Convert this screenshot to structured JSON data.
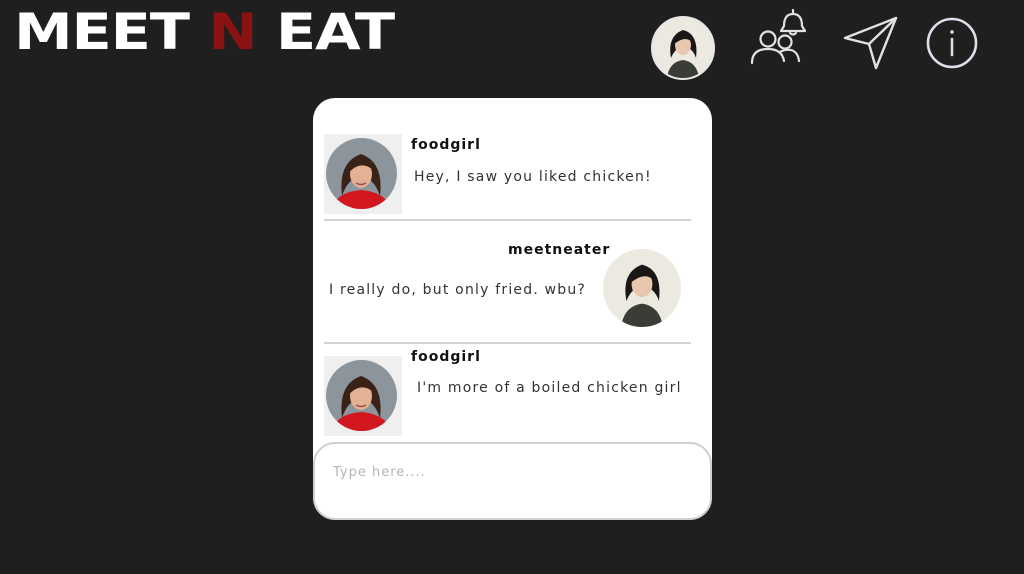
{
  "header": {
    "logo_part1": "MEET",
    "logo_part2": "N",
    "logo_part3": "EAT",
    "logo_accent_color": "#8b1212"
  },
  "nav": {
    "icons": [
      "profile-avatar",
      "friends-notification-icon",
      "send-icon",
      "info-icon"
    ]
  },
  "chat": {
    "messages": [
      {
        "user": "foodgirl",
        "text": "Hey, I saw you liked chicken!",
        "side": "left"
      },
      {
        "user": "meetneater",
        "text": "I really do, but only fried. wbu?",
        "side": "right"
      },
      {
        "user": "foodgirl",
        "text": "I'm more of a boiled chicken girl",
        "side": "left"
      }
    ],
    "input_placeholder": "Type here...."
  }
}
